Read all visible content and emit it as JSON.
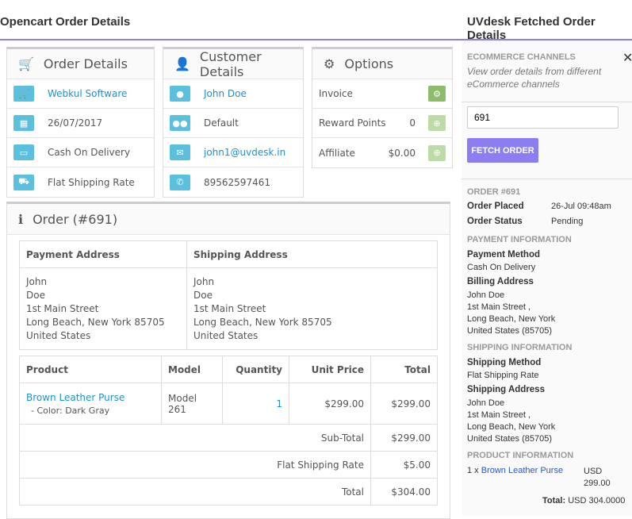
{
  "left": {
    "title": "Opencart Order Details",
    "order_details": {
      "title": "Order Details",
      "store": "Webkul Software",
      "date": "26/07/2017",
      "payment": "Cash On Delivery",
      "shipping": "Flat Shipping Rate"
    },
    "customer_details": {
      "title": "Customer Details",
      "name": "John Doe",
      "group": "Default",
      "email": "john1@uvdesk.in",
      "phone": "89562597461"
    },
    "options": {
      "title": "Options",
      "invoice": "Invoice",
      "reward_label": "Reward Points",
      "reward_value": "0",
      "affiliate_label": "Affiliate",
      "affiliate_value": "$0.00"
    },
    "order": {
      "title": "Order (#691)",
      "payment_address_header": "Payment Address",
      "shipping_address_header": "Shipping Address",
      "payment_address": [
        "John",
        "Doe",
        "1st Main Street",
        "Long Beach, New York 85705",
        "United States"
      ],
      "shipping_address": [
        "John",
        "Doe",
        "1st Main Street",
        "Long Beach, New York 85705",
        "United States"
      ],
      "columns": [
        "Product",
        "Model",
        "Quantity",
        "Unit Price",
        "Total"
      ],
      "product": {
        "name": "Brown Leather Purse",
        "option": "- Color: Dark Gray",
        "model": "Model 261",
        "quantity": "1",
        "unit_price": "$299.00",
        "total": "$299.00"
      },
      "totals": [
        {
          "label": "Sub-Total",
          "value": "$299.00"
        },
        {
          "label": "Flat Shipping Rate",
          "value": "$5.00"
        },
        {
          "label": "Total",
          "value": "$304.00"
        }
      ]
    }
  },
  "right": {
    "title": "UVdesk Fetched Order Details",
    "channels_heading": "ECOMMERCE CHANNELS",
    "channels_desc": "View order details from different eCommerce channels",
    "order_input": "691",
    "fetch_button": "FETCH ORDER",
    "order_number": "ORDER #691",
    "order_placed_label": "Order Placed",
    "order_placed": "26-Jul 09:48am",
    "order_status_label": "Order Status",
    "order_status": "Pending",
    "payment_heading": "PAYMENT INFORMATION",
    "payment_method_label": "Payment Method",
    "payment_method": "Cash On Delivery",
    "billing_label": "Billing Address",
    "billing": [
      "John Doe",
      "1st Main Street ,",
      "Long Beach, New York",
      "United States (85705)"
    ],
    "shipping_heading": "SHIPPING INFORMATION",
    "shipping_method_label": "Shipping Method",
    "shipping_method": "Flat Shipping Rate",
    "shipping_address_label": "Shipping Address",
    "shipping_address": [
      "John Doe",
      "1st Main Street ,",
      "Long Beach, New York",
      "United States (85705)"
    ],
    "product_heading": "PRODUCT INFORMATION",
    "product_qty": "1 x",
    "product_name": "Brown Leather Purse",
    "product_currency": "USD",
    "product_price": "299.00",
    "total_label": "Total:",
    "total_value": "USD 304.0000"
  },
  "colors": {
    "accent": "#8b7ef0",
    "info": "#5bc0de",
    "success": "#8fbb6c",
    "link": "#1e91cf"
  }
}
